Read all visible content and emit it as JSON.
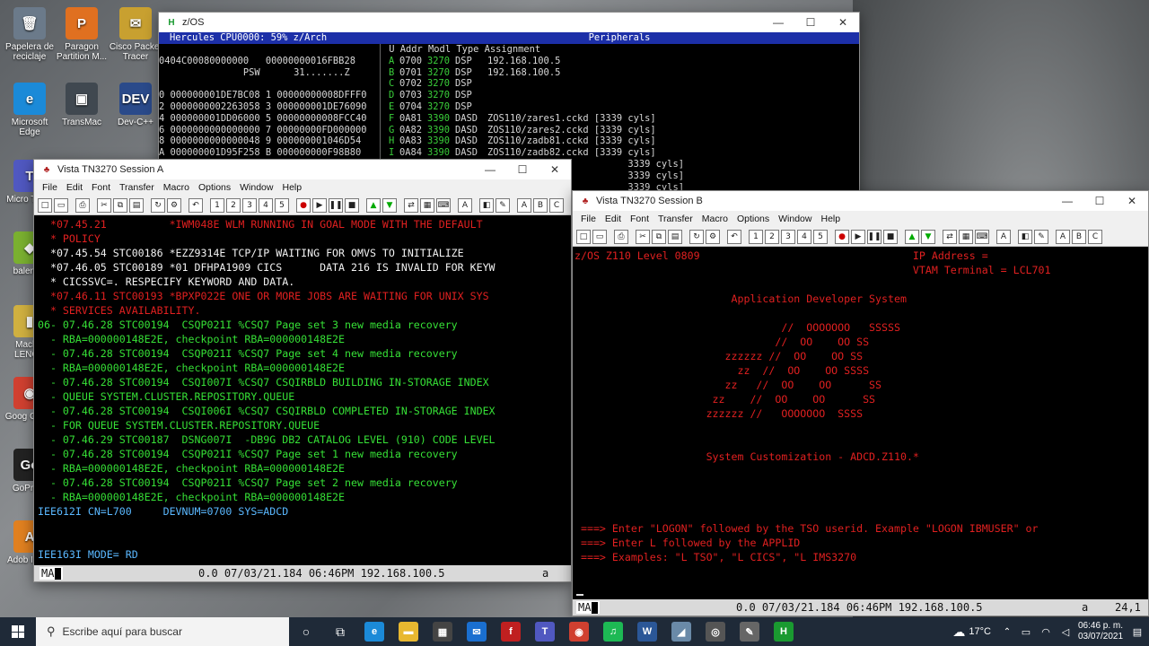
{
  "desktop": {
    "icons": [
      {
        "label": "Papelera de reciclaje",
        "glyph": "🗑",
        "color": "#6b7a8a"
      },
      {
        "label": "Paragon Partition M...",
        "glyph": "P",
        "color": "#e07020"
      },
      {
        "label": "Cisco Packet Tracer",
        "glyph": "✉",
        "color": "#c8a030"
      },
      {
        "label": "Microsoft Edge",
        "glyph": "e",
        "color": "#1b8ad8"
      },
      {
        "label": "TransMac",
        "glyph": "▣",
        "color": "#404850"
      },
      {
        "label": "Dev-C++",
        "glyph": "DEV",
        "color": "#2a4a8a"
      },
      {
        "label": "Micro Team",
        "glyph": "T",
        "color": "#5058c0"
      },
      {
        "label": "balenaE",
        "glyph": "◆",
        "color": "#7ab030"
      },
      {
        "label": "Mackin LENOV",
        "glyph": "▮",
        "color": "#d0b040"
      },
      {
        "label": "Goog Chron",
        "glyph": "◉",
        "color": "#d04030"
      },
      {
        "label": "GoPro S",
        "glyph": "Go",
        "color": "#222"
      },
      {
        "label": "Adob Illustr",
        "glyph": "A",
        "color": "#e08020"
      }
    ]
  },
  "hercules": {
    "title": "z/OS",
    "header_left": "Hercules  CPU0000:  59%     z/Arch",
    "header_right": "Peripherals",
    "left_lines": [
      "",
      "0404C00080000000   00000000016FBB28",
      "               PSW      31.......Z",
      "",
      "0 000000001DE7BC08 1 00000000008DFFF0",
      "2 0000000002263058 3 000000001DE76090",
      "4 000000001DD06000 5 00000000008FCC40",
      "6 0000000000000000 7 00000000FD000000",
      "8 0000000000000048 9 000000001046D54",
      "A 000000001D95F258 B 000000000F98B80"
    ],
    "right_header": " U Addr Modl Type Assignment",
    "devices": [
      {
        "u": "A",
        "addr": "0700",
        "modl": "3270",
        "type": "DSP",
        "assign": "192.168.100.5"
      },
      {
        "u": "B",
        "addr": "0701",
        "modl": "3270",
        "type": "DSP",
        "assign": "192.168.100.5"
      },
      {
        "u": "C",
        "addr": "0702",
        "modl": "3270",
        "type": "DSP",
        "assign": ""
      },
      {
        "u": "D",
        "addr": "0703",
        "modl": "3270",
        "type": "DSP",
        "assign": ""
      },
      {
        "u": "E",
        "addr": "0704",
        "modl": "3270",
        "type": "DSP",
        "assign": ""
      },
      {
        "u": "F",
        "addr": "0A81",
        "modl": "3390",
        "type": "DASD",
        "assign": "ZOS110/zares1.cckd [3339 cyls]"
      },
      {
        "u": "G",
        "addr": "0A82",
        "modl": "3390",
        "type": "DASD",
        "assign": "ZOS110/zares2.cckd [3339 cyls]"
      },
      {
        "u": "H",
        "addr": "0A83",
        "modl": "3390",
        "type": "DASD",
        "assign": "ZOS110/zadb81.cckd [3339 cyls]"
      },
      {
        "u": "I",
        "addr": "0A84",
        "modl": "3390",
        "type": "DASD",
        "assign": "ZOS110/zadb82.cckd [3339 cyls]"
      },
      {
        "u": "",
        "addr": "",
        "modl": "",
        "type": "",
        "assign": "                         3339 cyls]"
      },
      {
        "u": "",
        "addr": "",
        "modl": "",
        "type": "",
        "assign": "                         3339 cyls]"
      },
      {
        "u": "",
        "addr": "",
        "modl": "",
        "type": "",
        "assign": "                         3339 cyls]"
      }
    ]
  },
  "session_a": {
    "title": "Vista TN3270 Session A",
    "menu": [
      "File",
      "Edit",
      "Font",
      "Transfer",
      "Macro",
      "Options",
      "Window",
      "Help"
    ],
    "lines": [
      {
        "color": "red",
        "text": "  *07.45.21          *IWM048E WLM RUNNING IN GOAL MODE WITH THE DEFAULT"
      },
      {
        "color": "red",
        "text": "  * POLICY"
      },
      {
        "color": "white",
        "text": "  *07.45.54 STC00186 *EZZ9314E TCP/IP WAITING FOR OMVS TO INITIALIZE"
      },
      {
        "color": "white",
        "text": "  *07.46.05 STC00189 *01 DFHPA1909 CICS      DATA 216 IS INVALID FOR KEYW"
      },
      {
        "color": "white",
        "text": "  * CICSSVC=. RESPECIFY KEYWORD AND DATA."
      },
      {
        "color": "red",
        "text": "  *07.46.11 STC00193 *BPXP022E ONE OR MORE JOBS ARE WAITING FOR UNIX SYS"
      },
      {
        "color": "red",
        "text": "  * SERVICES AVAILABILITY."
      },
      {
        "color": "green",
        "text": "06- 07.46.28 STC00194  CSQP021I %CSQ7 Page set 3 new media recovery"
      },
      {
        "color": "green",
        "text": "  - RBA=000000148E2E, checkpoint RBA=000000148E2E"
      },
      {
        "color": "green",
        "text": "  - 07.46.28 STC00194  CSQP021I %CSQ7 Page set 4 new media recovery"
      },
      {
        "color": "green",
        "text": "  - RBA=000000148E2E, checkpoint RBA=000000148E2E"
      },
      {
        "color": "green",
        "text": "  - 07.46.28 STC00194  CSQI007I %CSQ7 CSQIRBLD BUILDING IN-STORAGE INDEX"
      },
      {
        "color": "green",
        "text": "  - QUEUE SYSTEM.CLUSTER.REPOSITORY.QUEUE"
      },
      {
        "color": "green",
        "text": "  - 07.46.28 STC00194  CSQI006I %CSQ7 CSQIRBLD COMPLETED IN-STORAGE INDEX"
      },
      {
        "color": "green",
        "text": "  - FOR QUEUE SYSTEM.CLUSTER.REPOSITORY.QUEUE"
      },
      {
        "color": "green",
        "text": "  - 07.46.29 STC00187  DSNG007I  -DB9G DB2 CATALOG LEVEL (910) CODE LEVEL"
      },
      {
        "color": "green",
        "text": "  - 07.46.28 STC00194  CSQP021I %CSQ7 Page set 1 new media recovery"
      },
      {
        "color": "green",
        "text": "  - RBA=000000148E2E, checkpoint RBA=000000148E2E"
      },
      {
        "color": "green",
        "text": "  - 07.46.28 STC00194  CSQP021I %CSQ7 Page set 2 new media recovery"
      },
      {
        "color": "green",
        "text": "  - RBA=000000148E2E, checkpoint RBA=000000148E2E"
      },
      {
        "color": "cyan",
        "text": "IEE612I CN=L700     DEVNUM=0700 SYS=ADCD"
      },
      {
        "color": "cyan",
        "text": ""
      },
      {
        "color": "cyan",
        "text": ""
      },
      {
        "color": "cyan",
        "text": "IEE163I MODE= RD"
      }
    ],
    "status_left": "MA",
    "status_center": "0.0 07/03/21.184 06:46PM 192.168.100.5",
    "status_right": "a"
  },
  "session_b": {
    "title": "Vista TN3270 Session B",
    "menu": [
      "File",
      "Edit",
      "Font",
      "Transfer",
      "Macro",
      "Options",
      "Window",
      "Help"
    ],
    "lines": [
      "z/OS Z110 Level 0809                                  IP Address =",
      "                                                      VTAM Terminal = LCL701",
      "",
      "                         Application Developer System",
      "",
      "                                 //  OOOOOOO   SSSSS",
      "                                //  OO    OO SS",
      "                        zzzzzz //  OO    OO SS",
      "                          zz  //  OO    OO SSSS",
      "                        zz   //  OO    OO      SS",
      "                      zz    //  OO    OO      SS",
      "                     zzzzzz //   OOOOOOO  SSSS",
      "",
      "",
      "                     System Customization - ADCD.Z110.*",
      "",
      "",
      "",
      "",
      " ===> Enter \"LOGON\" followed by the TSO userid. Example \"LOGON IBMUSER\" or",
      " ===> Enter L followed by the APPLID",
      " ===> Examples: \"L TSO\", \"L CICS\", \"L IMS3270"
    ],
    "status_left": "MA",
    "status_center": "0.0 07/03/21.184 06:46PM 192.168.100.5",
    "status_right": "a",
    "cursor_pos": "24,1"
  },
  "taskbar": {
    "search_placeholder": "Escribe aquí para buscar",
    "temperature": "17°C",
    "time": "06:46 p. m.",
    "date": "03/07/2021",
    "pins": [
      {
        "name": "edge",
        "glyph": "e",
        "color": "#1b8ad8"
      },
      {
        "name": "explorer",
        "glyph": "▬",
        "color": "#e8b830"
      },
      {
        "name": "store",
        "glyph": "▦",
        "color": "#444"
      },
      {
        "name": "mail",
        "glyph": "✉",
        "color": "#1a6fd0"
      },
      {
        "name": "flash",
        "glyph": "f",
        "color": "#c02020"
      },
      {
        "name": "teams",
        "glyph": "T",
        "color": "#5058c0"
      },
      {
        "name": "chrome",
        "glyph": "◉",
        "color": "#d04030"
      },
      {
        "name": "spotify",
        "glyph": "♫",
        "color": "#1db954"
      },
      {
        "name": "word",
        "glyph": "W",
        "color": "#2b5797"
      },
      {
        "name": "app",
        "glyph": "◢",
        "color": "#6a8aa8"
      },
      {
        "name": "vmware",
        "glyph": "◎",
        "color": "#555"
      },
      {
        "name": "tool",
        "glyph": "✎",
        "color": "#666"
      },
      {
        "name": "hercules",
        "glyph": "H",
        "color": "#1a9a30"
      }
    ]
  }
}
